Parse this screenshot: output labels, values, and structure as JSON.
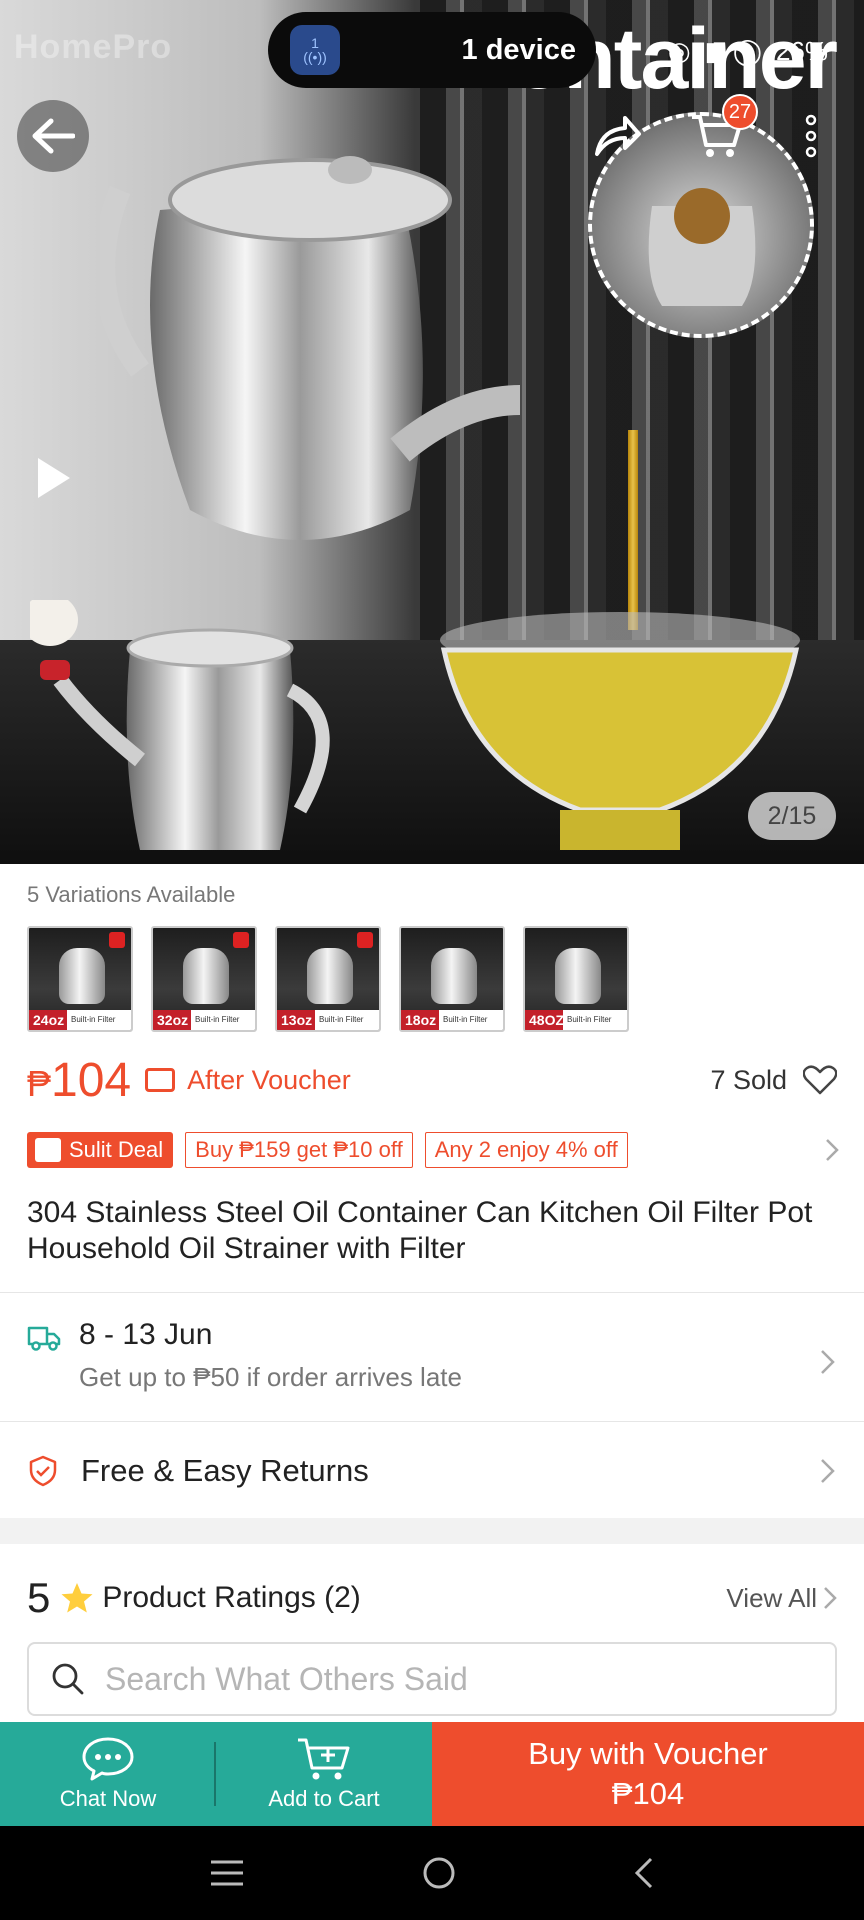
{
  "hero": {
    "brand": "HomePro",
    "title_text": "ontainer",
    "cast_badge": "1",
    "cast_label": "1 device",
    "battery": "26%",
    "cart_count": "27",
    "counter": "2/15"
  },
  "variations": {
    "label": "5 Variations Available",
    "items": [
      {
        "tag": "24oz",
        "strip": "Built-in Filter",
        "red": true
      },
      {
        "tag": "32oz",
        "strip": "Built-in Filter",
        "red": true
      },
      {
        "tag": "13oz",
        "strip": "Built-in Filter",
        "red": true
      },
      {
        "tag": "18oz",
        "strip": "Built-in Filter",
        "red": false
      },
      {
        "tag": "48OZ",
        "strip": "Built-in Filter",
        "red": false
      }
    ]
  },
  "price": {
    "currency": "₱",
    "amount": "104",
    "after_voucher": "After Voucher",
    "sold": "7 Sold"
  },
  "promos": {
    "sulit": "Sulit Deal",
    "chip1": "Buy ₱159 get ₱10 off",
    "chip2": "Any 2 enjoy 4% off"
  },
  "product": {
    "title": "304 Stainless Steel Oil Container Can Kitchen Oil Filter Pot Household Oil Strainer with Filter"
  },
  "shipping": {
    "date": "8 - 13 Jun",
    "note": "Get up to ₱50 if order arrives late"
  },
  "returns": {
    "label": "Free & Easy Returns"
  },
  "ratings": {
    "score": "5",
    "label": "Product Ratings (2)",
    "view_all": "View All",
    "search_placeholder": "Search What Others Said"
  },
  "bottom_bar": {
    "chat": "Chat Now",
    "add_to_cart": "Add to Cart",
    "buy_line1": "Buy with Voucher",
    "buy_line2": "₱104"
  },
  "colors": {
    "accent": "#ee4d2d",
    "teal": "#26aa99"
  }
}
